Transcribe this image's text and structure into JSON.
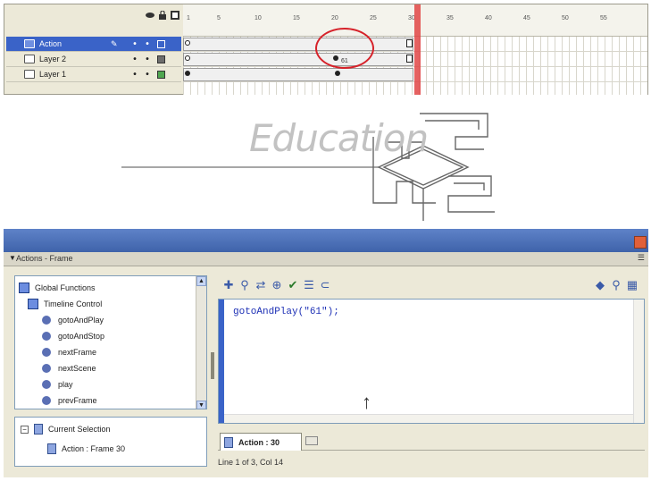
{
  "timeline": {
    "layers": [
      {
        "name": "Action",
        "selected": true
      },
      {
        "name": "Layer 2",
        "selected": false
      },
      {
        "name": "Layer 1",
        "selected": false
      }
    ],
    "ruler_ticks": [
      "1",
      "5",
      "10",
      "15",
      "20",
      "25",
      "30",
      "35",
      "40",
      "45",
      "50",
      "55"
    ],
    "frame_label": "61",
    "playhead_frame": 30,
    "colors": {
      "playhead": "#e04545",
      "selection": "#3a63c8",
      "annotation_circle": "#d6222a"
    }
  },
  "stage": {
    "logo_text": "Education"
  },
  "actions_panel": {
    "title": "Actions - Frame",
    "toolbox": {
      "items": [
        {
          "label": "Global Functions",
          "icon": "book-icon"
        },
        {
          "label": "Timeline Control",
          "icon": "book-icon"
        },
        {
          "label": "gotoAndPlay",
          "icon": "function-icon"
        },
        {
          "label": "gotoAndStop",
          "icon": "function-icon"
        },
        {
          "label": "nextFrame",
          "icon": "function-icon"
        },
        {
          "label": "nextScene",
          "icon": "function-icon"
        },
        {
          "label": "play",
          "icon": "function-icon"
        },
        {
          "label": "prevFrame",
          "icon": "function-icon"
        }
      ]
    },
    "script_navigator": {
      "current_selection": "Current Selection",
      "action_frame": "Action : Frame 30"
    },
    "editor": {
      "code": "gotoAndPlay(\"61\");"
    },
    "tab_label": "Action : 30",
    "status": "Line 1 of 3, Col 14"
  }
}
